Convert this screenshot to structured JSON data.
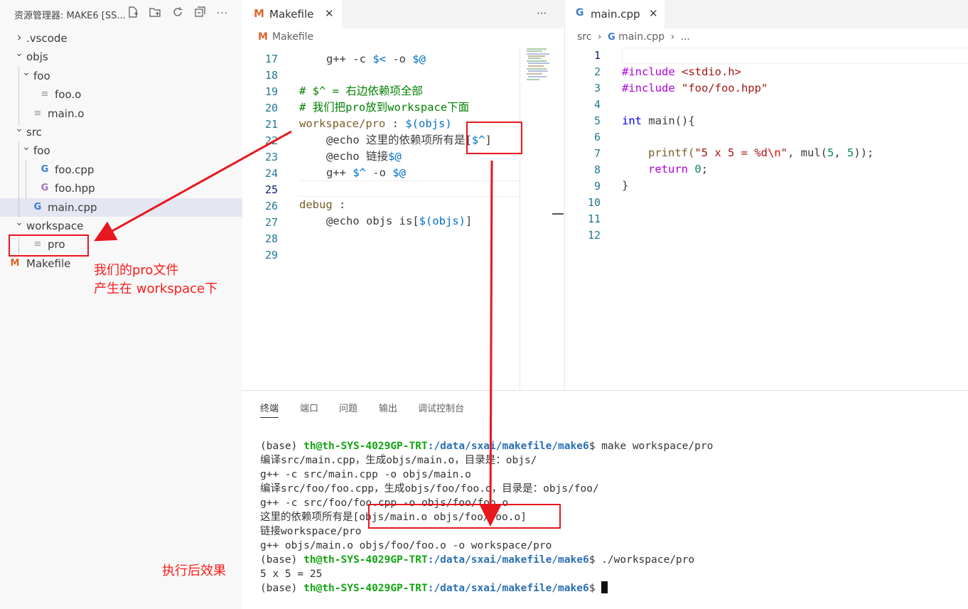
{
  "explorer": {
    "title": "资源管理器: MAKE6 [SS...",
    "header_icons": [
      "new-file-icon",
      "new-folder-icon",
      "refresh-icon",
      "collapse-all-icon",
      "more-icon"
    ],
    "items": [
      {
        "label": ".vscode",
        "kind": "folder",
        "expanded": false
      },
      {
        "label": "objs",
        "kind": "folder",
        "expanded": true
      },
      {
        "label": "foo",
        "kind": "folder",
        "expanded": true
      },
      {
        "label": "foo.o",
        "kind": "file"
      },
      {
        "label": "main.o",
        "kind": "file"
      },
      {
        "label": "src",
        "kind": "folder",
        "expanded": true
      },
      {
        "label": "foo",
        "kind": "folder",
        "expanded": true
      },
      {
        "label": "foo.cpp",
        "kind": "cpp"
      },
      {
        "label": "foo.hpp",
        "kind": "hpp"
      },
      {
        "label": "main.cpp",
        "kind": "cpp",
        "selected": true
      },
      {
        "label": "workspace",
        "kind": "folder",
        "expanded": true
      },
      {
        "label": "pro",
        "kind": "file"
      },
      {
        "label": "Makefile",
        "kind": "makefile"
      }
    ]
  },
  "editor_left": {
    "tab_label": "Makefile",
    "breadcrumb": "Makefile",
    "more_label": "···",
    "line_numbers": [
      "17",
      "18",
      "19",
      "20",
      "21",
      "22",
      "23",
      "24",
      "25",
      "26",
      "27",
      "28",
      "29"
    ],
    "code": {
      "l17_a": "g++ -c ",
      "l17_b": "$<",
      "l17_c": " -o ",
      "l17_d": "$@",
      "l19": "# $^ = 右边依赖项全部",
      "l20": "# 我们把pro放到workspace下面",
      "l21_a": "workspace/pro",
      "l21_b": " : ",
      "l21_c": "$(objs)",
      "l22_a": "@echo 这里的依赖项所有是[",
      "l22_b": "$^",
      "l22_c": "]",
      "l23_a": "@echo 链接",
      "l23_b": "$@",
      "l24_a": "g++ ",
      "l24_b": "$^",
      "l24_c": " -o ",
      "l24_d": "$@",
      "l26_a": "debug",
      "l26_b": " :",
      "l27_a": "@echo objs is[",
      "l27_b": "$(objs)",
      "l27_c": "]"
    }
  },
  "editor_right": {
    "tab_label": "main.cpp",
    "breadcrumb_src": "src",
    "breadcrumb_file": "main.cpp",
    "breadcrumb_more": "...",
    "line_numbers": [
      "1",
      "2",
      "3",
      "4",
      "5",
      "6",
      "7",
      "8",
      "9",
      "10",
      "11",
      "12"
    ],
    "code": {
      "l2_a": "#include",
      "l2_b": " <stdio.h>",
      "l3_a": "#include",
      "l3_b": " \"foo/foo.hpp\"",
      "l5_a": "int",
      "l5_b": " main(){",
      "l7_a": "printf(",
      "l7_b": "\"5 x 5 = %d",
      "l7_c": "\\n",
      "l7_d": "\"",
      "l7_e": ", mul(",
      "l7_f": "5",
      "l7_g": ", ",
      "l7_h": "5",
      "l7_i": "));",
      "l8_a": "return",
      "l8_b": " ",
      "l8_c": "0",
      "l8_d": ";",
      "l9": "}"
    }
  },
  "panel": {
    "tabs": [
      "终端",
      "端口",
      "问题",
      "输出",
      "调试控制台"
    ],
    "active_tab": "终端",
    "terminal": {
      "base": "(base) ",
      "user": "th@th-SYS-4029GP-TRT",
      "path": ":/data/sxai/makefile/make6",
      "dollar": "$ ",
      "cmd1": "make workspace/pro",
      "out1": "编译src/main.cpp，生成objs/main.o，目录是：objs/",
      "out2": "g++ -c src/main.cpp -o objs/main.o",
      "out3": "编译src/foo/foo.cpp，生成objs/foo/foo.o，目录是：objs/foo/",
      "out4": "g++ -c src/foo/foo.cpp -o objs/foo/foo.o",
      "out5_a": "这里的依赖项所有是",
      "out5_b": "[objs/main.o objs/foo/foo.o]",
      "out6": "链接workspace/pro",
      "out7": "g++ objs/main.o objs/foo/foo.o -o workspace/pro",
      "cmd2": "./workspace/pro",
      "out8": "5 x 5 = 25"
    }
  },
  "annotations": {
    "pro_note_line1": "我们的pro文件",
    "pro_note_line2": "产生在 workspace下",
    "result_note": "执行后效果",
    "accent_color": "#e8161d"
  }
}
